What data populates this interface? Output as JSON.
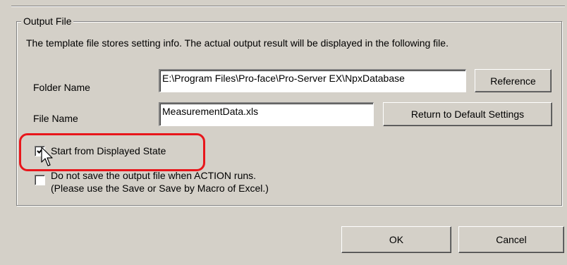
{
  "group": {
    "title": "Output File",
    "description": "The template file stores setting info. The actual output result will be displayed in the following file."
  },
  "folder": {
    "label": "Folder Name",
    "value": "E:\\Program Files\\Pro-face\\Pro-Server EX\\NpxDatabase",
    "button": "Reference"
  },
  "file": {
    "label": "File Name",
    "value": "MeasurementData.xls",
    "button": "Return to Default Settings"
  },
  "options": {
    "start_displayed": {
      "label": "Start from Displayed State",
      "checked": true
    },
    "no_save": {
      "line1": "Do not save the output file when ACTION runs.",
      "line2": "(Please use the Save or Save by Macro of Excel.)",
      "checked": false
    }
  },
  "footer": {
    "ok": "OK",
    "cancel": "Cancel"
  },
  "colors": {
    "highlight": "#e8161b",
    "background": "#d4d0c8"
  }
}
